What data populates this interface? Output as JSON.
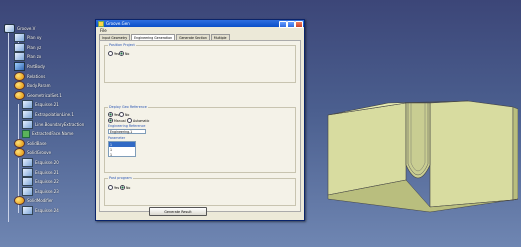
{
  "tree": {
    "nodes": [
      {
        "label": "Groove.V",
        "kind": "root"
      },
      {
        "label": "Plan xy",
        "kind": "sketch"
      },
      {
        "label": "Plan yz",
        "kind": "sketch"
      },
      {
        "label": "Plan zx",
        "kind": "sketch"
      },
      {
        "label": "PartBody",
        "kind": "body"
      },
      {
        "label": "Relations",
        "kind": "geo"
      },
      {
        "label": "Body.Param",
        "kind": "geo"
      },
      {
        "label": "GeometricalSet.1",
        "kind": "geo"
      },
      {
        "label": "Esquisse.21",
        "kind": "sketch"
      },
      {
        "label": "ExtrapolationLine.1",
        "kind": "sketch"
      },
      {
        "label": "Line.BoundaryExtraction",
        "kind": "sketch"
      },
      {
        "label": "ExtractedFace.Name",
        "kind": "check"
      },
      {
        "label": "SolidBase",
        "kind": "geo"
      },
      {
        "label": "SolidGroove",
        "kind": "geo"
      },
      {
        "label": "Esquisse.20",
        "kind": "sketch"
      },
      {
        "label": "Esquisse.21",
        "kind": "sketch"
      },
      {
        "label": "Esquisse.22",
        "kind": "sketch"
      },
      {
        "label": "Esquisse.23",
        "kind": "sketch"
      },
      {
        "label": "SolidModifier",
        "kind": "geo"
      },
      {
        "label": "Esquisse.24",
        "kind": "sketch"
      }
    ]
  },
  "dialog": {
    "title": "Groove.Gen",
    "menu_file": "File",
    "tabs": [
      "Input Geometry",
      "Engineering Generation",
      "Generate Section",
      "Multiple"
    ],
    "group1": {
      "label": "Position Project",
      "yes": "Yes",
      "no": "No"
    },
    "group2": {
      "label": "Deploy Geo Reference",
      "yes": "Yes",
      "no": "No",
      "manual": "Manual",
      "automatic": "Automatic",
      "field_label": "Engineering Reference",
      "field_value": "Engineering.1",
      "params_label": "Parameter",
      "params": [
        "1",
        "1",
        "1"
      ]
    },
    "group3": {
      "label": "Post program",
      "yes": "Yes",
      "no": "No"
    },
    "generate_button": "Generate Result"
  },
  "colors": {
    "viewport_top": "#3c4678",
    "viewport_bottom": "#6f86b2",
    "part_top": "#e8ecb2",
    "part_front": "#d8dca0",
    "part_side": "#b9be7e"
  }
}
